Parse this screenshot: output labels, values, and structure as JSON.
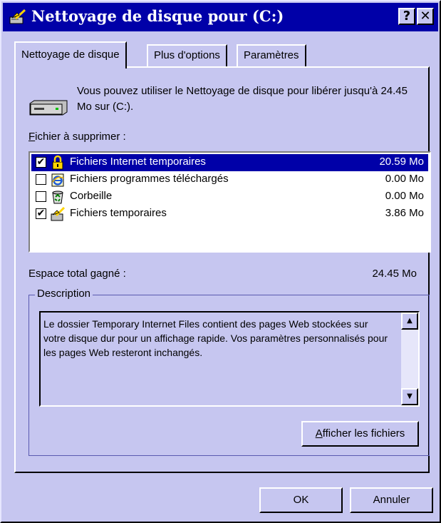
{
  "window": {
    "title": "Nettoyage de disque pour  (C:)",
    "help_button": "?",
    "close_button": "✕"
  },
  "tabs": [
    {
      "label": "Nettoyage de disque",
      "active": true
    },
    {
      "label": "Plus d'options",
      "active": false
    },
    {
      "label": "Paramètres",
      "active": false
    }
  ],
  "intro": {
    "text": "Vous pouvez utiliser le Nettoyage de disque pour libérer jusqu'à 24.45 Mo sur  (C:)."
  },
  "files_label": {
    "mnemonic": "F",
    "rest": "ichier à supprimer :"
  },
  "files": [
    {
      "name": "Fichiers Internet temporaires",
      "size": "20.59 Mo",
      "checked": "✔",
      "selected": true,
      "icon": "lock-folder-icon"
    },
    {
      "name": "Fichiers programmes téléchargés",
      "size": "0.00 Mo",
      "checked": "",
      "selected": false,
      "icon": "ie-page-icon"
    },
    {
      "name": "Corbeille",
      "size": "0.00 Mo",
      "checked": "",
      "selected": false,
      "icon": "recycle-bin-icon"
    },
    {
      "name": "Fichiers temporaires",
      "size": "3.86 Mo",
      "checked": "✔",
      "selected": false,
      "icon": "broom-icon"
    }
  ],
  "total": {
    "label": "Espace total gagné :",
    "value": "24.45 Mo"
  },
  "description": {
    "title": "Description",
    "text": "Le dossier Temporary Internet Files contient des pages Web stockées sur votre disque dur pour un affichage rapide. Vos paramètres personnalisés pour les pages Web resteront inchangés."
  },
  "buttons": {
    "view_files": {
      "mnemonic": "A",
      "rest": "fficher les fichiers"
    },
    "ok": "OK",
    "cancel": "Annuler"
  },
  "colors": {
    "titlebar": "#0000a8",
    "face": "#c6c6f0",
    "selection": "#0000a8"
  }
}
